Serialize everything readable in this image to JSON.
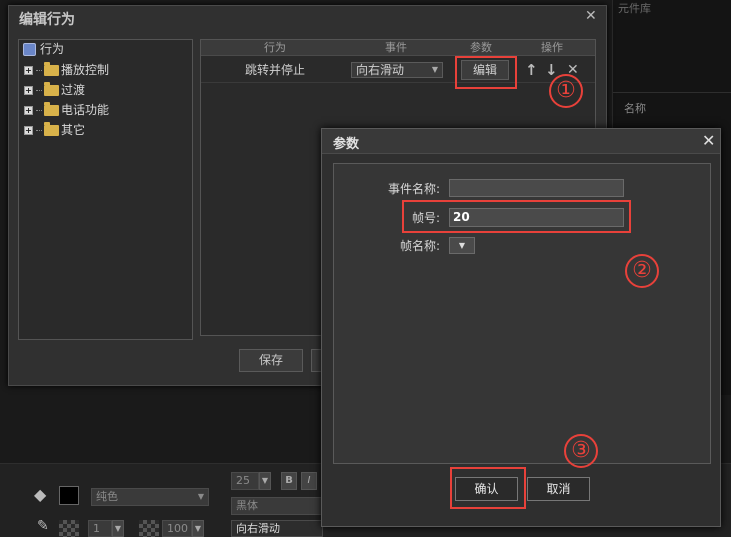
{
  "background": {
    "component_library_label": "元件库",
    "name_label": "名称",
    "fill_type": "纯色",
    "font_size": "25",
    "bold_label": "B",
    "italic_label": "I",
    "font_name": "黑体",
    "stroke_width": "1",
    "opacity": "100",
    "text_value": "向右滑动"
  },
  "edit_dialog": {
    "title": "编辑行为",
    "close_glyph": "✕",
    "tree": {
      "root": "行为",
      "items": [
        "播放控制",
        "过渡",
        "电话功能",
        "其它"
      ]
    },
    "columns": [
      "行为",
      "事件",
      "参数",
      "操作"
    ],
    "row": {
      "behavior": "跳转并停止",
      "event": "向右滑动",
      "param_button": "编辑"
    },
    "op_icons": [
      "↑",
      "↓",
      "✕"
    ],
    "save_label": "保存"
  },
  "params_dialog": {
    "title": "参数",
    "close_glyph": "✕",
    "event_name_label": "事件名称:",
    "event_name_value": "",
    "frame_number_label": "帧号:",
    "frame_number_value": "20",
    "frame_name_label": "帧名称:",
    "frame_name_value": "",
    "confirm_label": "确认",
    "cancel_label": "取消"
  },
  "annotations": [
    "①",
    "②",
    "③"
  ],
  "colors": {
    "annotation_red": "#e8413a",
    "folder_yellow": "#d8b24a"
  }
}
